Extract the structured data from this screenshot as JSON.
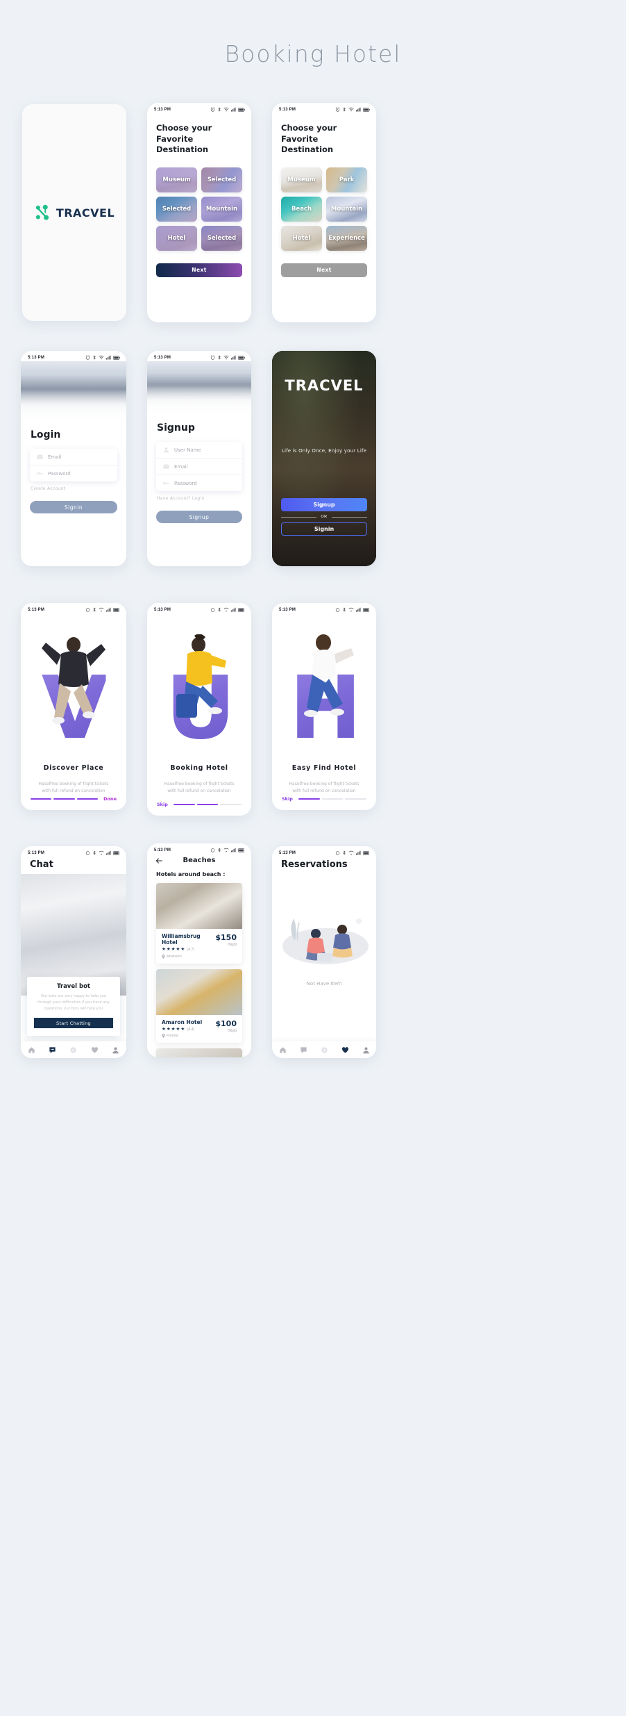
{
  "page": {
    "title": "Booking Hotel",
    "background": "#eef2f6"
  },
  "common": {
    "status_time": "5:13 PM",
    "brand": "TRACVEL",
    "brand_green": "#1fc08a",
    "brand_navy": "#18304f",
    "accent_purple": "#8b3fe8"
  },
  "screens": {
    "splash": {
      "logo_text": "TRACVEL"
    },
    "destination_partial": {
      "title": "Choose your Favorite Destination",
      "cards": [
        {
          "label": "Museum",
          "selected": false,
          "photo": "museum"
        },
        {
          "label": "Selected",
          "selected": true,
          "photo": "park"
        },
        {
          "label": "Selected",
          "selected": true,
          "photo": "beach"
        },
        {
          "label": "Mountain",
          "selected": false,
          "photo": "mount"
        },
        {
          "label": "Hotel",
          "selected": false,
          "photo": "hotel"
        },
        {
          "label": "Selected",
          "selected": true,
          "photo": "exper"
        }
      ],
      "next_label": "Next",
      "next_state": "active"
    },
    "destination_default": {
      "title": "Choose your Favorite Destination",
      "cards": [
        {
          "label": "Museum",
          "selected": false,
          "photo": "museum"
        },
        {
          "label": "Park",
          "selected": false,
          "photo": "park"
        },
        {
          "label": "Beach",
          "selected": false,
          "photo": "beach"
        },
        {
          "label": "Mountain",
          "selected": false,
          "photo": "mount"
        },
        {
          "label": "Hotel",
          "selected": false,
          "photo": "hotel"
        },
        {
          "label": "Experience",
          "selected": false,
          "photo": "exper"
        }
      ],
      "next_label": "Next",
      "next_state": "disabled"
    },
    "login": {
      "title": "Login",
      "fields": [
        {
          "icon": "envelope-icon",
          "placeholder": "Email"
        },
        {
          "icon": "key-icon",
          "placeholder": "Password"
        }
      ],
      "link": "Create Account",
      "button": "Signin"
    },
    "signup": {
      "title": "Signup",
      "fields": [
        {
          "icon": "person-icon",
          "placeholder": "User Name"
        },
        {
          "icon": "envelope-icon",
          "placeholder": "Email"
        },
        {
          "icon": "key-icon",
          "placeholder": "Password"
        }
      ],
      "link": "Have Account? Login",
      "button": "Signup"
    },
    "welcome": {
      "logo_text": "TRACVEL",
      "tagline": "Life is Only Once, Enjoy your Life",
      "signup_button": "Signup",
      "divider": "OR",
      "signin_button": "Signin"
    },
    "onboarding": [
      {
        "letter": "V",
        "title": "Discover Place",
        "description": "Haselfree booking of flight tickets with full refund on cancelation",
        "left_action": "",
        "right_action": "Done",
        "steps": 3,
        "filled": 3
      },
      {
        "letter": "U",
        "title": "Booking Hotel",
        "description": "Haselfree booking of flight tickets with full refund on cancelation",
        "left_action": "Skip",
        "right_action": "",
        "steps": 3,
        "filled": 2
      },
      {
        "letter": "H",
        "title": "Easy Find Hotel",
        "description": "Haselfree booking of flight tickets with full refund on cancelation",
        "left_action": "Skip",
        "right_action": "",
        "steps": 3,
        "filled": 1
      }
    ],
    "chat": {
      "title": "Chat",
      "bot_title": "Travel bot",
      "bot_desc": "Our bots are very happy to help you through your difficulties if you have any questions, our bots will help you",
      "button": "Start Chatting",
      "tabs": [
        {
          "icon": "home-icon",
          "active": false
        },
        {
          "icon": "chat-icon",
          "active": true
        },
        {
          "icon": "compass-icon",
          "active": false
        },
        {
          "icon": "heart-icon",
          "active": false
        },
        {
          "icon": "person-icon",
          "active": false
        }
      ]
    },
    "beaches": {
      "back_icon": "arrow-left-icon",
      "title": "Beaches",
      "subtitle": "Hotels around beach :",
      "hotels": [
        {
          "name": "Williamsbrug Hotel",
          "rating": "(4.7)",
          "stars": 4.5,
          "location": "Anaheim",
          "price": "$150",
          "per": "/Night",
          "photo": "hi-1"
        },
        {
          "name": "Amaron Hotel",
          "rating": "(4.4)",
          "stars": 4.5,
          "location": "Florida",
          "price": "$100",
          "per": "/Night",
          "photo": "hi-2"
        },
        {
          "name": "",
          "rating": "",
          "stars": 0,
          "location": "",
          "price": "",
          "per": "",
          "photo": "hi-3"
        }
      ]
    },
    "reservations": {
      "title": "Reservations",
      "empty_text": "Not Have Item",
      "tabs": [
        {
          "icon": "home-icon",
          "active": false
        },
        {
          "icon": "chat-icon",
          "active": false
        },
        {
          "icon": "compass-icon",
          "active": false
        },
        {
          "icon": "heart-icon",
          "active": true
        },
        {
          "icon": "person-icon",
          "active": false
        }
      ]
    }
  }
}
